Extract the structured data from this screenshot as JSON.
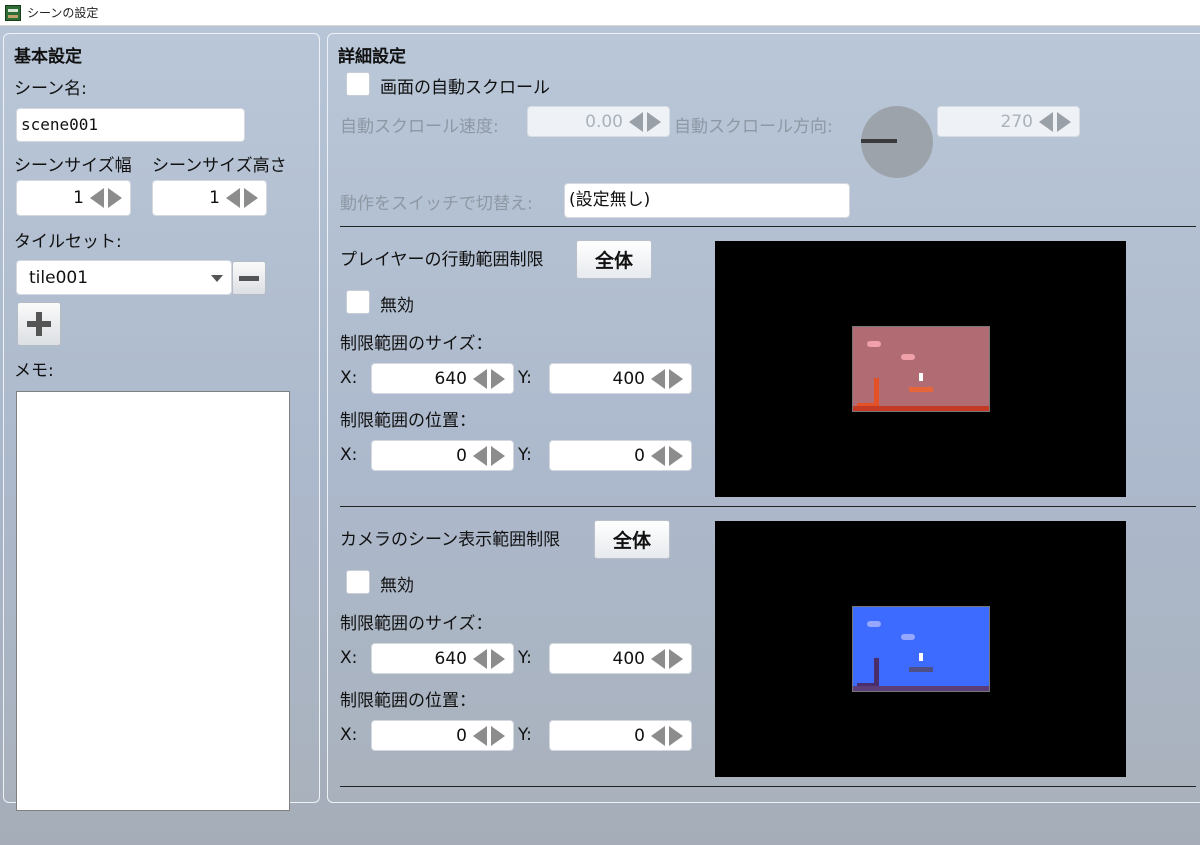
{
  "window": {
    "title": "シーンの設定"
  },
  "basic": {
    "heading": "基本設定",
    "scene_name_label": "シーン名:",
    "scene_name_value": "scene001",
    "width_label": "シーンサイズ幅",
    "height_label": "シーンサイズ高さ",
    "width_value": "1",
    "height_value": "1",
    "tileset_label": "タイルセット:",
    "tileset_value": "tile001",
    "memo_label": "メモ:",
    "memo_value": ""
  },
  "detail": {
    "heading": "詳細設定",
    "autoscroll_label": "画面の自動スクロール",
    "autoscroll_checked": false,
    "speed_label": "自動スクロール速度:",
    "speed_value": "0.00",
    "direction_label": "自動スクロール方向:",
    "direction_value": "270",
    "switch_label": "動作をスイッチで切替え:",
    "switch_value": "(設定無し)"
  },
  "player_limit": {
    "title": "プレイヤーの行動範囲制限",
    "all_button": "全体",
    "disable_label": "無効",
    "disabled_checked": false,
    "size_label": "制限範囲のサイズ：",
    "pos_label": "制限範囲の位置：",
    "x_label": "X:",
    "y_label": "Y:",
    "size_x": "640",
    "size_y": "400",
    "pos_x": "0",
    "pos_y": "0"
  },
  "camera_limit": {
    "title": "カメラのシーン表示範囲制限",
    "all_button": "全体",
    "disable_label": "無効",
    "disabled_checked": false,
    "size_label": "制限範囲のサイズ：",
    "pos_label": "制限範囲の位置：",
    "x_label": "X:",
    "y_label": "Y:",
    "size_x": "640",
    "size_y": "400",
    "pos_x": "0",
    "pos_y": "0"
  },
  "colors": {
    "player_preview": "#b06b73",
    "camera_preview": "#3d6bff",
    "panel_background": "#b8c6d8"
  },
  "icons": {
    "title_icon": "app-icon",
    "remove_tileset": "minus-icon",
    "add_tileset": "plus-icon",
    "direction_dial": "dial-icon"
  }
}
